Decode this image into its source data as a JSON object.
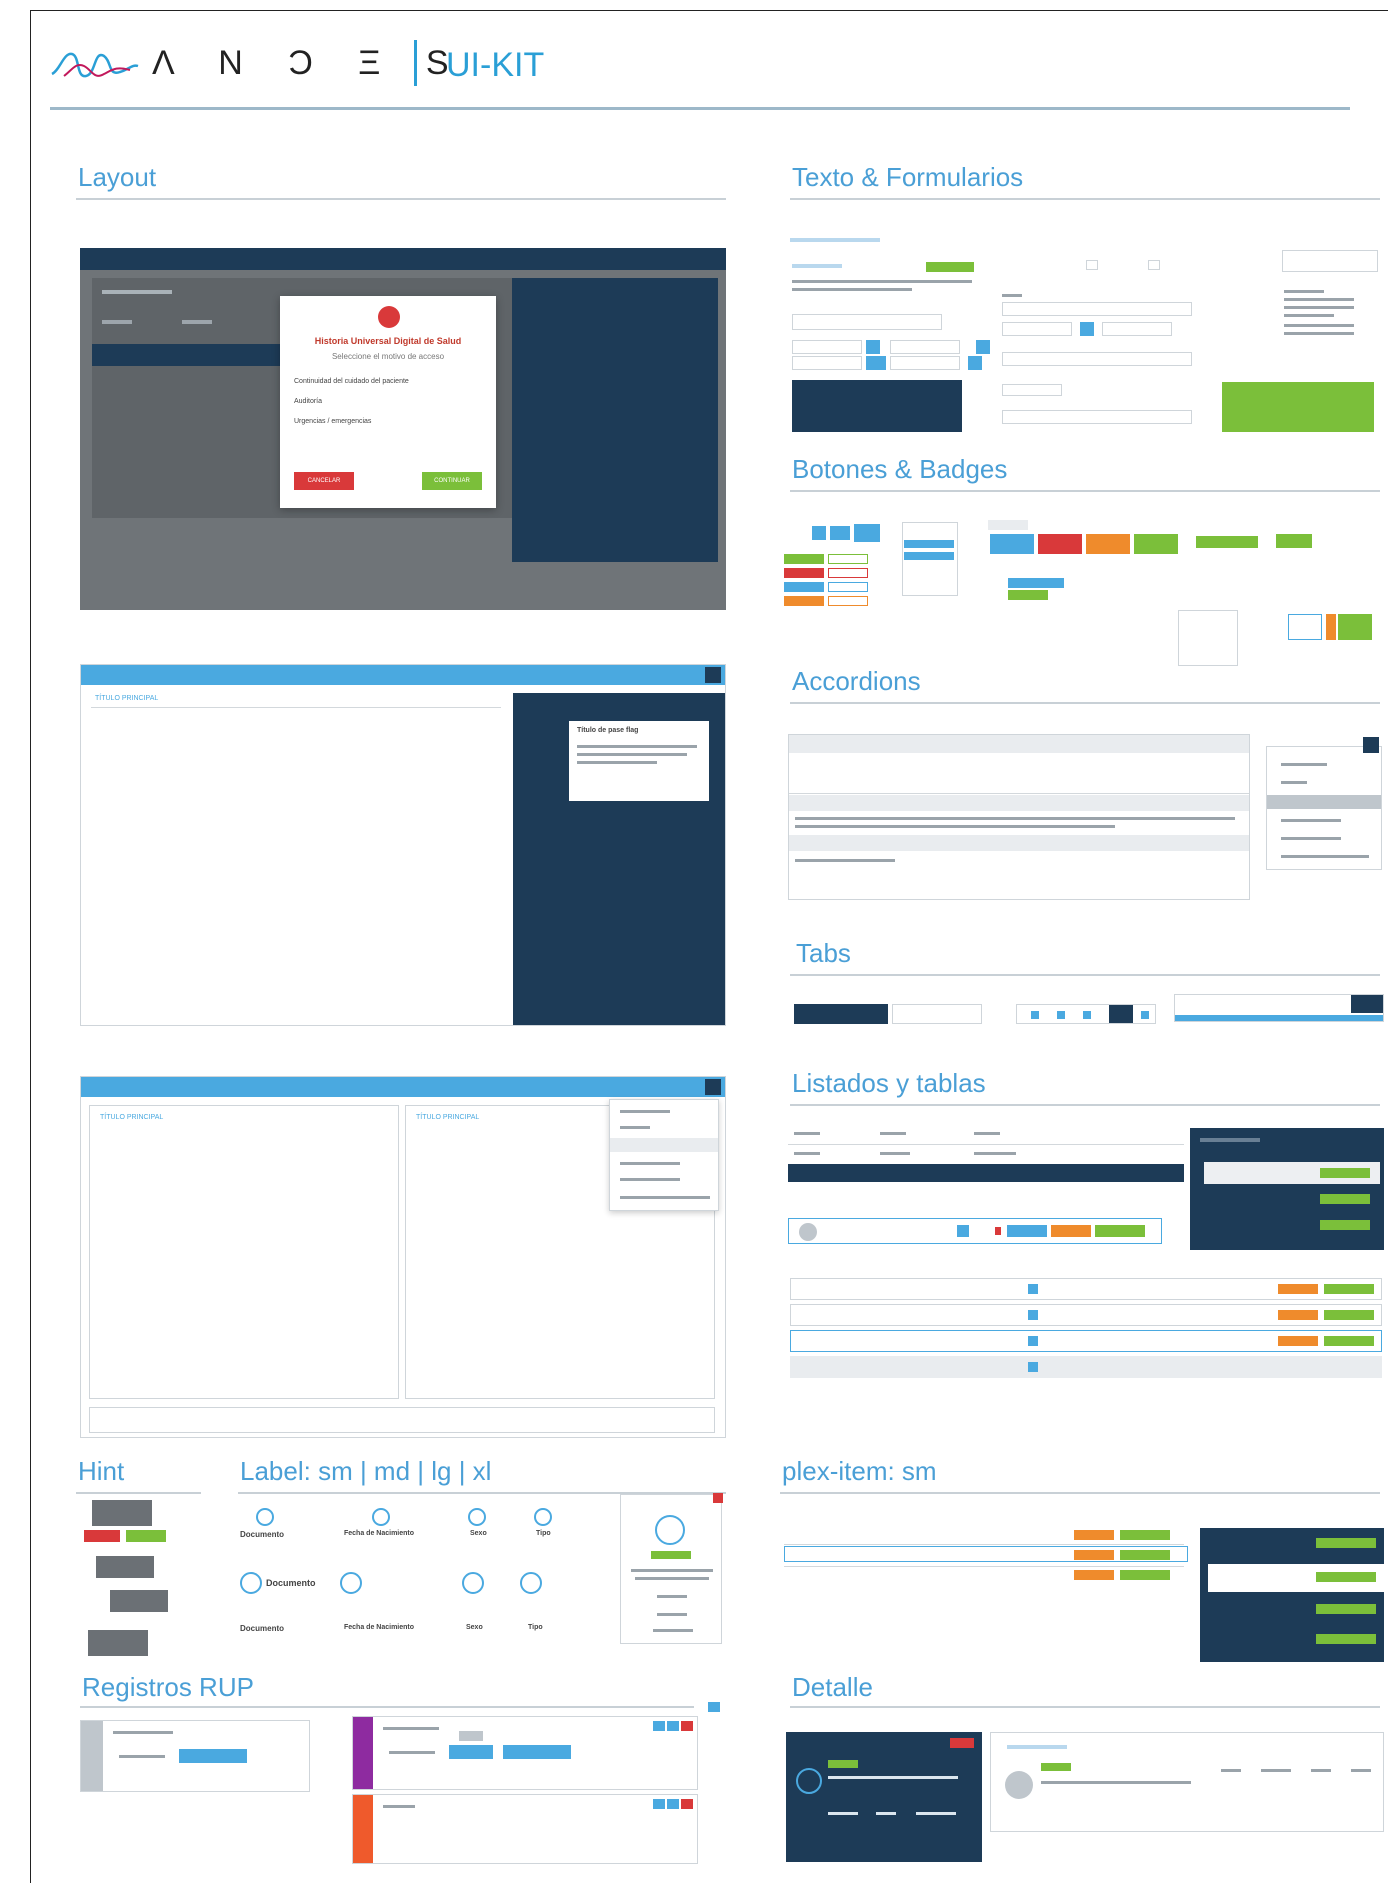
{
  "header": {
    "brand": "Λ N Ͻ Ξ S",
    "product": "UI-KIT"
  },
  "sections": {
    "layout": "Layout",
    "texto": "Texto & Formularios",
    "botones": "Botones & Badges",
    "accordions": "Accordions",
    "tabs": "Tabs",
    "listados": "Listados y tablas",
    "hint": "Hint",
    "label": "Label: sm | md | lg | xl",
    "plex": "plex-item: sm",
    "registros": "Registros RUP",
    "detalle": "Detalle"
  },
  "layout_demo": {
    "modal_title": "Historia Universal Digital de Salud",
    "modal_subtitle": "Seleccione el motivo de acceso",
    "options": [
      "Continuidad del cuidado del paciente",
      "Auditoría",
      "Urgencias / emergencias"
    ],
    "cancel": "CANCELAR",
    "confirm": "CONTINUAR",
    "titulo_principal": "TÍTULO PRINCIPAL",
    "card_title": "Título de pase flag"
  },
  "labels": {
    "documento": "Documento",
    "fecha": "Fecha de Nacimiento",
    "sexo": "Sexo",
    "tipo": "Tipo"
  },
  "colors": {
    "accent": "#4aa9e0",
    "dark": "#1d3b57",
    "success": "#7bbf3a",
    "warning": "#ef8b2c",
    "danger": "#d9393a"
  }
}
